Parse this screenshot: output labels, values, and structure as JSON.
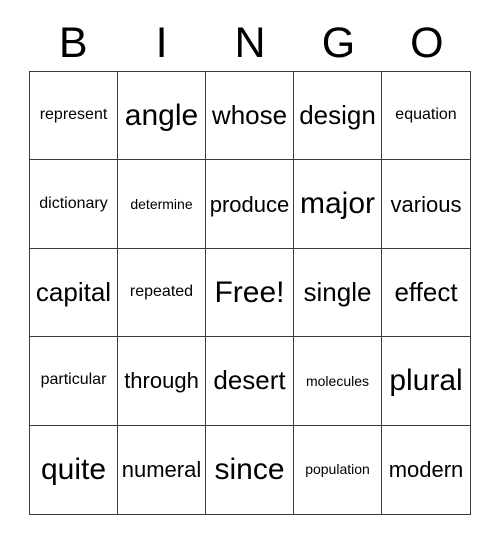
{
  "card": {
    "title": "BINGO",
    "header_letters": [
      "B",
      "I",
      "N",
      "G",
      "O"
    ],
    "free_space_label": "Free!",
    "rows": 5,
    "columns": 5,
    "colors": {
      "background": "#ffffff",
      "grid_line": "#3a3a3a",
      "text": "#000000"
    },
    "grid": [
      [
        {
          "text": "represent",
          "size": "s-sm"
        },
        {
          "text": "angle",
          "size": "s-xl"
        },
        {
          "text": "whose",
          "size": "s-lg"
        },
        {
          "text": "design",
          "size": "s-lg"
        },
        {
          "text": "equation",
          "size": "s-sm"
        }
      ],
      [
        {
          "text": "dictionary",
          "size": "s-sm"
        },
        {
          "text": "determine",
          "size": "s-xs"
        },
        {
          "text": "produce",
          "size": "s-md"
        },
        {
          "text": "major",
          "size": "s-xl"
        },
        {
          "text": "various",
          "size": "s-md"
        }
      ],
      [
        {
          "text": "capital",
          "size": "s-lg"
        },
        {
          "text": "repeated",
          "size": "s-sm"
        },
        {
          "text": "Free!",
          "size": "s-free"
        },
        {
          "text": "single",
          "size": "s-lg"
        },
        {
          "text": "effect",
          "size": "s-lg"
        }
      ],
      [
        {
          "text": "particular",
          "size": "s-sm"
        },
        {
          "text": "through",
          "size": "s-md"
        },
        {
          "text": "desert",
          "size": "s-lg"
        },
        {
          "text": "molecules",
          "size": "s-xs"
        },
        {
          "text": "plural",
          "size": "s-xl"
        }
      ],
      [
        {
          "text": "quite",
          "size": "s-xl"
        },
        {
          "text": "numeral",
          "size": "s-md"
        },
        {
          "text": "since",
          "size": "s-xl"
        },
        {
          "text": "population",
          "size": "s-xs"
        },
        {
          "text": "modern",
          "size": "s-md"
        }
      ]
    ]
  }
}
